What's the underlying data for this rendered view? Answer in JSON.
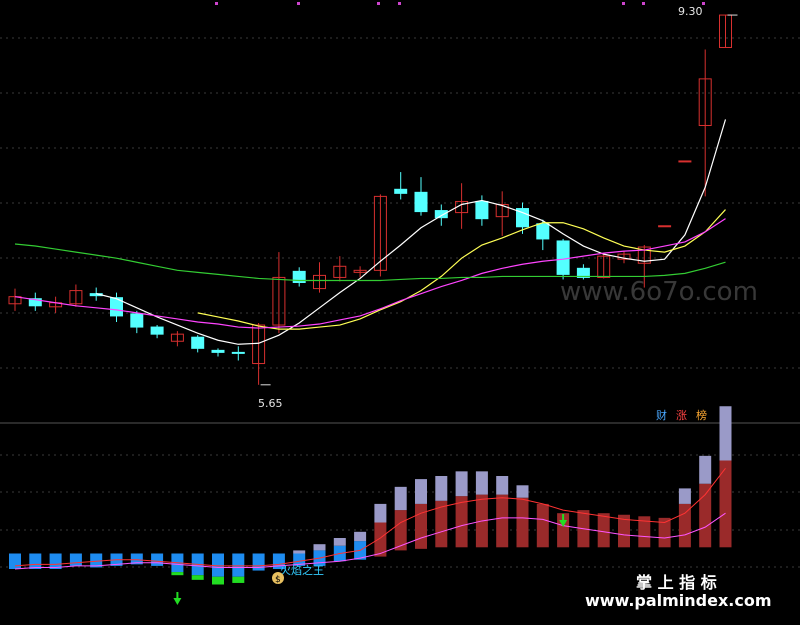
{
  "colors": {
    "background": "#000000",
    "up": "#d8302f",
    "down": "#54ffff",
    "ma_fast": "#ffffff",
    "ma_mid": "#ffff55",
    "ma_slow": "#ff44ff",
    "ma_long": "#33cc33",
    "bar_blue": "#1e8cf0",
    "bar_light": "#9a9ac8",
    "bar_red": "#9a2a2a",
    "bar_green": "#22dd22"
  },
  "annotations": {
    "low_label": "5.65",
    "high_label": "9.30",
    "signal_label": "火焰之王"
  },
  "badges": [
    {
      "text": "财",
      "color": "#4aa8ff"
    },
    {
      "text": "涨",
      "color": "#ff4444"
    },
    {
      "text": "榜",
      "color": "#ffaa33"
    }
  ],
  "watermarks": {
    "center": "www.6o7o.com",
    "bottom_title": "掌 上 指 标",
    "bottom_url": "www.palmindex.com"
  },
  "chart_data": [
    {
      "type": "candlestick",
      "title": "",
      "ylim": [
        5.5,
        9.35
      ],
      "candles": [
        {
          "o": 6.45,
          "c": 6.52,
          "h": 6.6,
          "l": 6.38
        },
        {
          "o": 6.5,
          "c": 6.43,
          "h": 6.56,
          "l": 6.38
        },
        {
          "o": 6.42,
          "c": 6.46,
          "h": 6.52,
          "l": 6.36
        },
        {
          "o": 6.45,
          "c": 6.58,
          "h": 6.64,
          "l": 6.42
        },
        {
          "o": 6.55,
          "c": 6.53,
          "h": 6.61,
          "l": 6.48
        },
        {
          "o": 6.51,
          "c": 6.33,
          "h": 6.56,
          "l": 6.27
        },
        {
          "o": 6.35,
          "c": 6.22,
          "h": 6.38,
          "l": 6.16
        },
        {
          "o": 6.22,
          "c": 6.15,
          "h": 6.24,
          "l": 6.11
        },
        {
          "o": 6.08,
          "c": 6.15,
          "h": 6.18,
          "l": 6.03
        },
        {
          "o": 6.12,
          "c": 6.01,
          "h": 6.14,
          "l": 5.97
        },
        {
          "o": 5.99,
          "c": 5.97,
          "h": 6.01,
          "l": 5.93
        },
        {
          "o": 5.97,
          "c": 5.96,
          "h": 6.03,
          "l": 5.89
        },
        {
          "o": 5.86,
          "c": 6.24,
          "h": 6.26,
          "l": 5.65
        },
        {
          "o": 6.24,
          "c": 6.71,
          "h": 6.96,
          "l": 6.16
        },
        {
          "o": 6.77,
          "c": 6.66,
          "h": 6.81,
          "l": 6.62
        },
        {
          "o": 6.6,
          "c": 6.73,
          "h": 6.86,
          "l": 6.56
        },
        {
          "o": 6.71,
          "c": 6.82,
          "h": 6.92,
          "l": 6.67
        },
        {
          "o": 6.76,
          "c": 6.78,
          "h": 6.82,
          "l": 6.71
        },
        {
          "o": 6.78,
          "c": 7.51,
          "h": 7.53,
          "l": 6.72
        },
        {
          "o": 7.58,
          "c": 7.54,
          "h": 7.75,
          "l": 7.48
        },
        {
          "o": 7.55,
          "c": 7.36,
          "h": 7.7,
          "l": 7.32
        },
        {
          "o": 7.37,
          "c": 7.3,
          "h": 7.43,
          "l": 7.22
        },
        {
          "o": 7.35,
          "c": 7.46,
          "h": 7.64,
          "l": 7.19
        },
        {
          "o": 7.46,
          "c": 7.29,
          "h": 7.52,
          "l": 7.22
        },
        {
          "o": 7.31,
          "c": 7.43,
          "h": 7.56,
          "l": 7.12
        },
        {
          "o": 7.39,
          "c": 7.21,
          "h": 7.45,
          "l": 7.14
        },
        {
          "o": 7.24,
          "c": 7.09,
          "h": 7.28,
          "l": 6.98
        },
        {
          "o": 7.07,
          "c": 6.74,
          "h": 7.09,
          "l": 6.69
        },
        {
          "o": 6.8,
          "c": 6.71,
          "h": 6.84,
          "l": 6.69
        },
        {
          "o": 6.71,
          "c": 6.92,
          "h": 6.94,
          "l": 6.7
        },
        {
          "o": 6.89,
          "c": 6.94,
          "h": 6.97,
          "l": 6.85
        },
        {
          "o": 6.85,
          "c": 7.01,
          "h": 7.03,
          "l": 6.61
        },
        {
          "o": 7.22,
          "c": 7.22,
          "h": 7.22,
          "l": 7.22
        },
        {
          "o": 7.86,
          "c": 7.86,
          "h": 7.86,
          "l": 7.86
        },
        {
          "o": 8.21,
          "c": 8.67,
          "h": 8.96,
          "l": 7.51
        },
        {
          "o": 8.98,
          "c": 9.3,
          "h": 9.3,
          "l": 8.98
        }
      ],
      "moving_averages": [
        {
          "color_key": "ma_fast",
          "values": [
            null,
            null,
            null,
            null,
            6.55,
            6.5,
            6.41,
            6.32,
            6.24,
            6.16,
            6.09,
            6.05,
            6.06,
            6.14,
            6.26,
            6.41,
            6.56,
            6.7,
            6.87,
            7.03,
            7.2,
            7.32,
            7.43,
            7.47,
            7.42,
            7.35,
            7.27,
            7.14,
            7.02,
            6.94,
            6.9,
            6.87,
            6.89,
            7.13,
            7.6,
            8.27
          ]
        },
        {
          "color_key": "ma_mid",
          "values": [
            null,
            null,
            null,
            null,
            null,
            null,
            null,
            null,
            null,
            6.36,
            6.32,
            6.28,
            6.23,
            6.2,
            6.2,
            6.22,
            6.24,
            6.3,
            6.39,
            6.47,
            6.58,
            6.72,
            6.9,
            7.03,
            7.1,
            7.18,
            7.25,
            7.25,
            7.19,
            7.1,
            7.02,
            6.98,
            6.96,
            7.02,
            7.16,
            7.38
          ]
        },
        {
          "color_key": "ma_slow",
          "values": [
            6.52,
            6.49,
            6.46,
            6.43,
            6.41,
            6.39,
            6.36,
            6.33,
            6.3,
            6.27,
            6.25,
            6.22,
            6.21,
            6.22,
            6.23,
            6.25,
            6.29,
            6.33,
            6.4,
            6.48,
            6.55,
            6.62,
            6.68,
            6.75,
            6.8,
            6.84,
            6.87,
            6.89,
            6.92,
            6.95,
            6.97,
            6.98,
            7.02,
            7.06,
            7.16,
            7.29
          ]
        },
        {
          "color_key": "ma_long",
          "values": [
            7.04,
            7.02,
            6.99,
            6.96,
            6.93,
            6.9,
            6.86,
            6.82,
            6.78,
            6.76,
            6.74,
            6.72,
            6.7,
            6.69,
            6.68,
            6.68,
            6.68,
            6.68,
            6.68,
            6.69,
            6.7,
            6.7,
            6.71,
            6.71,
            6.72,
            6.72,
            6.72,
            6.72,
            6.72,
            6.72,
            6.72,
            6.72,
            6.73,
            6.75,
            6.8,
            6.86
          ]
        }
      ],
      "annotations": [
        {
          "text_key": "low_label",
          "candle": 12,
          "price": 5.65
        },
        {
          "text_key": "high_label",
          "candle": 35,
          "price": 9.3
        }
      ]
    },
    {
      "type": "bar",
      "title": "",
      "ylim": [
        0,
        100
      ],
      "bars": [
        {
          "base": 20,
          "top": 30,
          "color_key": "bar_blue"
        },
        {
          "base": 20,
          "top": 30,
          "color_key": "bar_blue"
        },
        {
          "base": 20,
          "top": 30,
          "color_key": "bar_blue"
        },
        {
          "base": 22,
          "top": 30,
          "color_key": "bar_blue"
        },
        {
          "base": 21,
          "top": 30,
          "color_key": "bar_blue"
        },
        {
          "base": 22,
          "top": 30,
          "color_key": "bar_blue"
        },
        {
          "base": 23,
          "top": 30,
          "color_key": "bar_blue"
        },
        {
          "base": 22,
          "top": 30,
          "color_key": "bar_blue"
        },
        {
          "base": 18,
          "top": 30,
          "color_key": "bar_blue",
          "foot": "bar_green",
          "foot_h": 2
        },
        {
          "base": 16,
          "top": 30,
          "color_key": "bar_blue",
          "foot": "bar_green",
          "foot_h": 3
        },
        {
          "base": 15,
          "top": 30,
          "color_key": "bar_blue",
          "foot": "bar_green",
          "foot_h": 5
        },
        {
          "base": 15,
          "top": 30,
          "color_key": "bar_blue",
          "foot": "bar_green",
          "foot_h": 4
        },
        {
          "base": 19,
          "top": 30,
          "color_key": "bar_blue"
        },
        {
          "base": 20,
          "top": 30,
          "color_key": "bar_blue"
        },
        {
          "base": 22,
          "top": 30,
          "color_key": "bar_blue",
          "cap": 2
        },
        {
          "base": 22,
          "top": 32,
          "color_key": "bar_blue",
          "cap": 4
        },
        {
          "base": 25,
          "top": 35,
          "color_key": "bar_blue",
          "cap": 5
        },
        {
          "base": 26,
          "top": 38,
          "color_key": "bar_blue",
          "cap": 6
        },
        {
          "base": 28,
          "top": 50,
          "color_key": "bar_red",
          "cap": 12
        },
        {
          "base": 32,
          "top": 58,
          "color_key": "bar_red",
          "cap": 15
        },
        {
          "base": 33,
          "top": 62,
          "color_key": "bar_red",
          "cap": 16
        },
        {
          "base": 34,
          "top": 64,
          "color_key": "bar_red",
          "cap": 16
        },
        {
          "base": 34,
          "top": 67,
          "color_key": "bar_red",
          "cap": 16
        },
        {
          "base": 34,
          "top": 68,
          "color_key": "bar_red",
          "cap": 15
        },
        {
          "base": 34,
          "top": 68,
          "color_key": "bar_red",
          "cap": 12
        },
        {
          "base": 34,
          "top": 66,
          "color_key": "bar_red",
          "cap": 8
        },
        {
          "base": 34,
          "top": 62,
          "color_key": "bar_red",
          "cap": 0
        },
        {
          "base": 34,
          "top": 56,
          "color_key": "bar_red"
        },
        {
          "base": 34,
          "top": 58,
          "color_key": "bar_red"
        },
        {
          "base": 34,
          "top": 56,
          "color_key": "bar_red"
        },
        {
          "base": 34,
          "top": 55,
          "color_key": "bar_red"
        },
        {
          "base": 34,
          "top": 54,
          "color_key": "bar_red"
        },
        {
          "base": 34,
          "top": 53,
          "color_key": "bar_red"
        },
        {
          "base": 34,
          "top": 62,
          "color_key": "bar_red",
          "cap": 10
        },
        {
          "base": 34,
          "top": 75,
          "color_key": "bar_red",
          "cap": 18
        },
        {
          "base": 34,
          "top": 90,
          "color_key": "bar_red",
          "cap": 35
        }
      ],
      "lines": [
        {
          "color": "#ff55ff",
          "values": [
            20,
            21,
            21,
            22,
            22,
            23,
            24,
            24,
            23,
            22,
            21,
            21,
            21,
            22,
            23,
            24,
            25,
            27,
            30,
            35,
            40,
            44,
            48,
            51,
            53,
            53,
            52,
            48,
            46,
            44,
            42,
            41,
            40,
            42,
            47,
            56
          ]
        },
        {
          "color": "#ff3333",
          "values": [
            22,
            23,
            23,
            24,
            25,
            26,
            26,
            25,
            24,
            23,
            22,
            22,
            22,
            23,
            25,
            27,
            30,
            32,
            40,
            50,
            56,
            60,
            63,
            65,
            66,
            65,
            62,
            58,
            56,
            54,
            52,
            51,
            50,
            56,
            68,
            85
          ]
        }
      ],
      "down_arrows": [
        8,
        27
      ],
      "signal_candle": 13
    }
  ]
}
